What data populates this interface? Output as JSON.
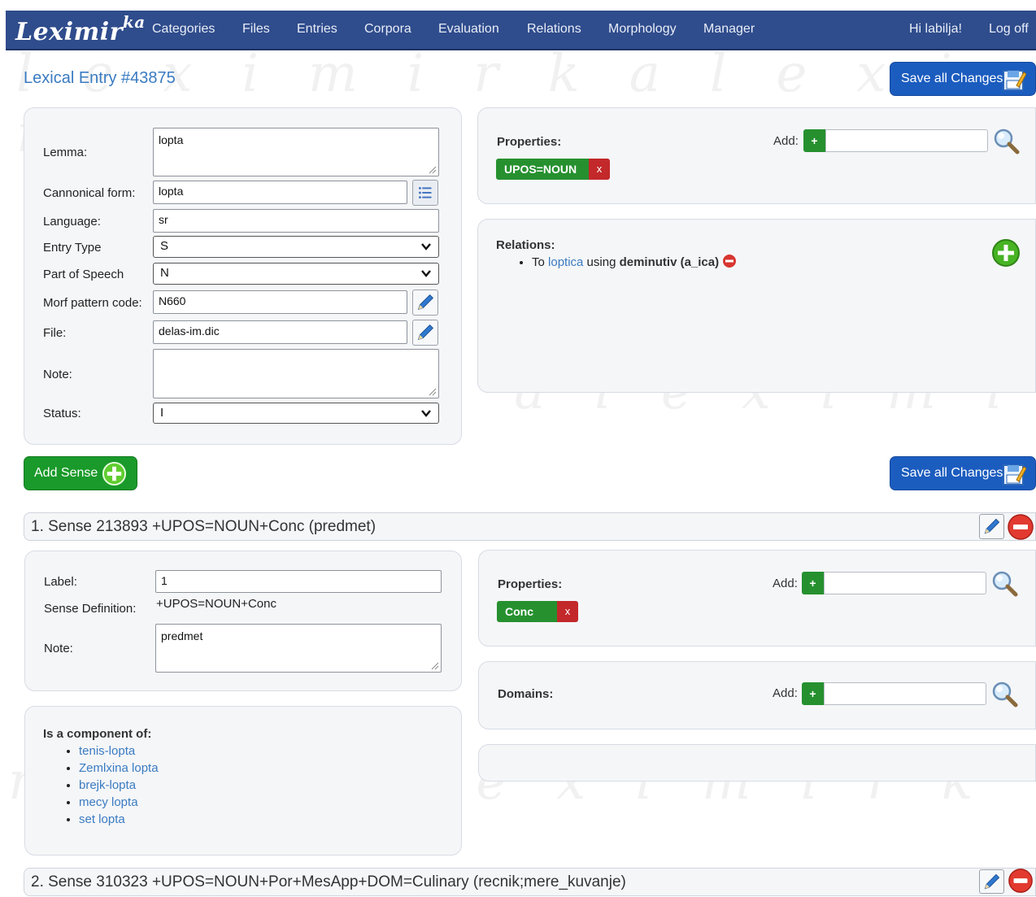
{
  "app": {
    "logo": "Leximir",
    "logo_sup": "ka"
  },
  "nav": {
    "items": [
      "Categories",
      "Files",
      "Entries",
      "Corpora",
      "Evaluation",
      "Relations",
      "Morphology",
      "Manager"
    ],
    "greeting": "Hi labilja!",
    "logoff": "Log off"
  },
  "page": {
    "title": "Lexical Entry #43875",
    "save_label": "Save all Changes",
    "watermark": "leximirka"
  },
  "entry": {
    "lemma_label": "Lemma:",
    "lemma": "lopta",
    "canonical_label": "Cannonical form:",
    "canonical": "lopta",
    "language_label": "Language:",
    "language": "sr",
    "entry_type_label": "Entry Type",
    "entry_type": "S",
    "pos_label": "Part of Speech",
    "pos": "N",
    "morf_label": "Morf pattern code:",
    "morf": "N660",
    "file_label": "File:",
    "file": "delas-im.dic",
    "note_label": "Note:",
    "note": "",
    "status_label": "Status:",
    "status": "I"
  },
  "properties": {
    "label": "Properties:",
    "add_label": "Add:",
    "plus": "+",
    "chips": [
      {
        "text": "UPOS=NOUN",
        "remove": "x"
      }
    ]
  },
  "relations": {
    "label": "Relations:",
    "items": [
      {
        "prefix": "To",
        "target": "loptica",
        "middle": "using",
        "type": "deminutiv (a_ica)"
      }
    ]
  },
  "add_sense_label": "Add Sense",
  "senses": [
    {
      "header": "1. Sense 213893 +UPOS=NOUN+Conc (predmet)",
      "label_label": "Label:",
      "label": "1",
      "definition_label": "Sense Definition:",
      "definition": "+UPOS=NOUN+Conc",
      "note_label": "Note:",
      "note": "predmet",
      "properties_label": "Properties:",
      "add_label": "Add:",
      "plus": "+",
      "chips": [
        {
          "text": "Conc",
          "remove": "x"
        }
      ],
      "domains_label": "Domains:",
      "component_label": "Is a component of:",
      "components": [
        "tenis-lopta",
        "Zemlxina lopta",
        "brejk-lopta",
        "mecy lopta",
        "set lopta"
      ]
    },
    {
      "header": "2. Sense 310323 +UPOS=NOUN+Por+MesApp+DOM=Culinary (recnik;mere_kuvanje)"
    }
  ],
  "colors": {
    "nav": "#2f4c8c",
    "accent_blue": "#1b5cbf",
    "green": "#26902f",
    "red": "#c3282a",
    "link": "#3a7bc1"
  }
}
